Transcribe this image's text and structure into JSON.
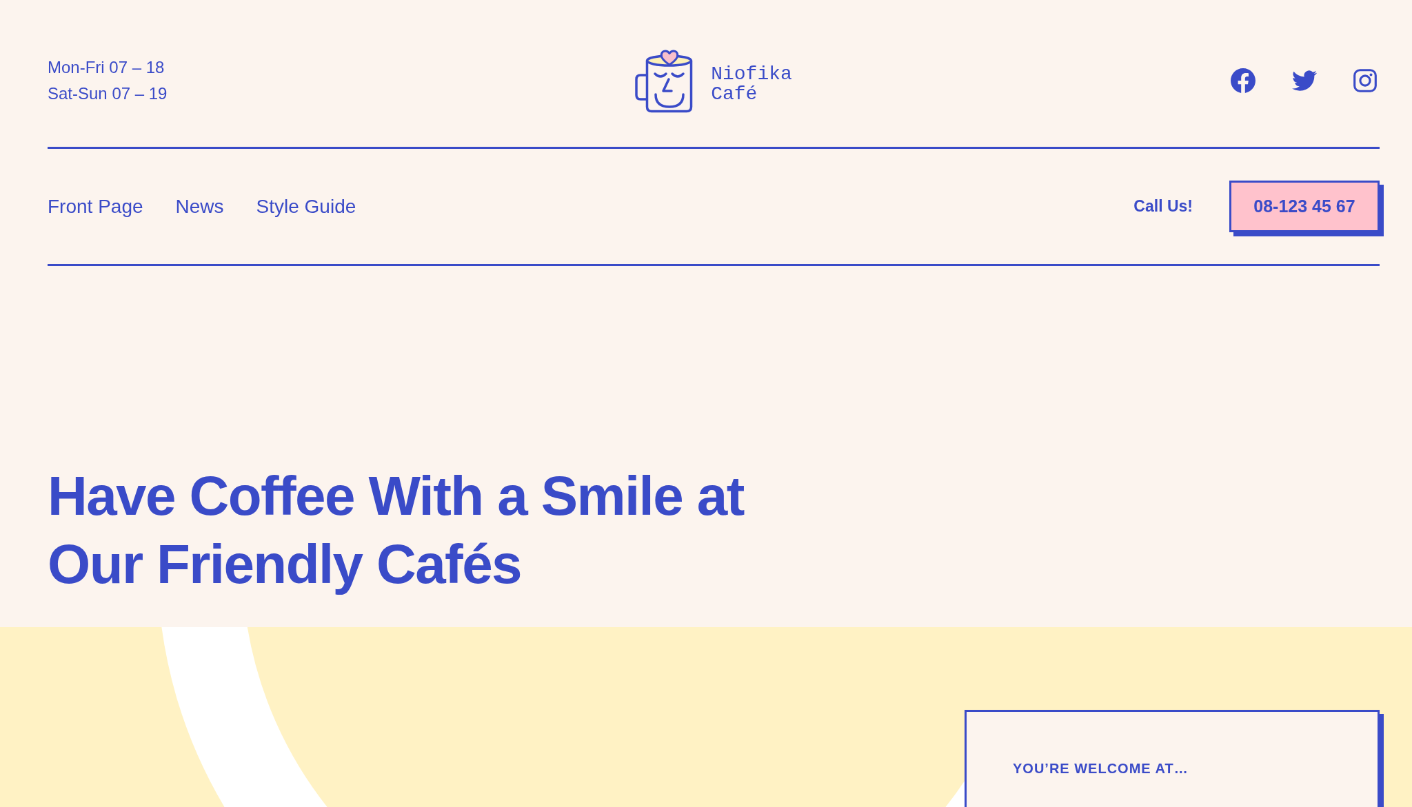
{
  "header": {
    "hours": [
      "Mon-Fri 07 – 18",
      "Sat-Sun 07 – 19"
    ],
    "logo_text": "Niofika Café"
  },
  "nav": {
    "links": [
      "Front Page",
      "News",
      "Style Guide"
    ],
    "call_label": "Call Us!",
    "phone_button": "08-123 45 67"
  },
  "hero": {
    "heading": "Have Coffee With a Smile at Our Friendly Cafés"
  },
  "welcome_card": {
    "heading": "YOU’RE WELCOME AT…"
  }
}
